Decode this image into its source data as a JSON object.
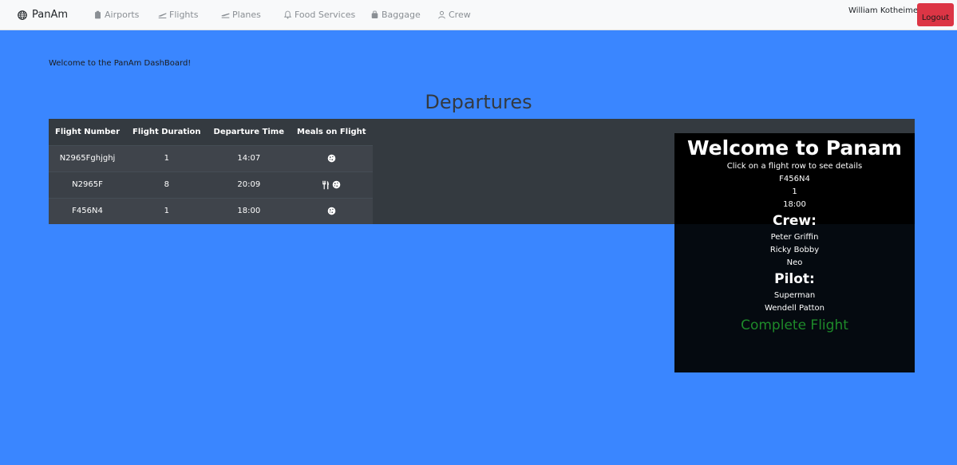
{
  "navbar": {
    "brand": "PanAm",
    "items": [
      {
        "label": "Airports"
      },
      {
        "label": "Flights"
      },
      {
        "label": "Planes"
      },
      {
        "label": "Food Services"
      },
      {
        "label": "Baggage"
      },
      {
        "label": "Crew"
      }
    ],
    "user_name": "William Kotheimer",
    "logout_label": "Logout"
  },
  "welcome_message": "Welcome to the PanAm DashBoard!",
  "section_title": "Departures",
  "table": {
    "headers": [
      "Flight Number",
      "Flight Duration",
      "Departure Time",
      "Meals on Flight"
    ],
    "rows": [
      {
        "flight_number": "N2965Fghjghj",
        "duration": "1",
        "departure": "14:07",
        "meals": "cookie-icon"
      },
      {
        "flight_number": "N2965F",
        "duration": "8",
        "departure": "20:09",
        "meals": "utensils-cookie-icon"
      },
      {
        "flight_number": "F456N4",
        "duration": "1",
        "departure": "18:00",
        "meals": "cookie-icon"
      }
    ]
  },
  "detail_panel": {
    "heading": "Welcome to Panam",
    "instruction": "Click on a flight row to see details",
    "flight_number": "F456N4",
    "duration": "1",
    "departure": "18:00",
    "crew_heading": "Crew:",
    "crew": [
      "Peter Griffin",
      "Ricky Bobby",
      "Neo"
    ],
    "pilot_heading": "Pilot:",
    "pilots": [
      "Superman",
      "Wendell Patton"
    ],
    "complete_label": "Complete Flight"
  },
  "colors": {
    "page_background": "#3a86ff",
    "navbar": "#f8f9fa",
    "table_dark": "#343a40",
    "logout": "#dc3545",
    "complete_flight": "#1e8a2a"
  }
}
